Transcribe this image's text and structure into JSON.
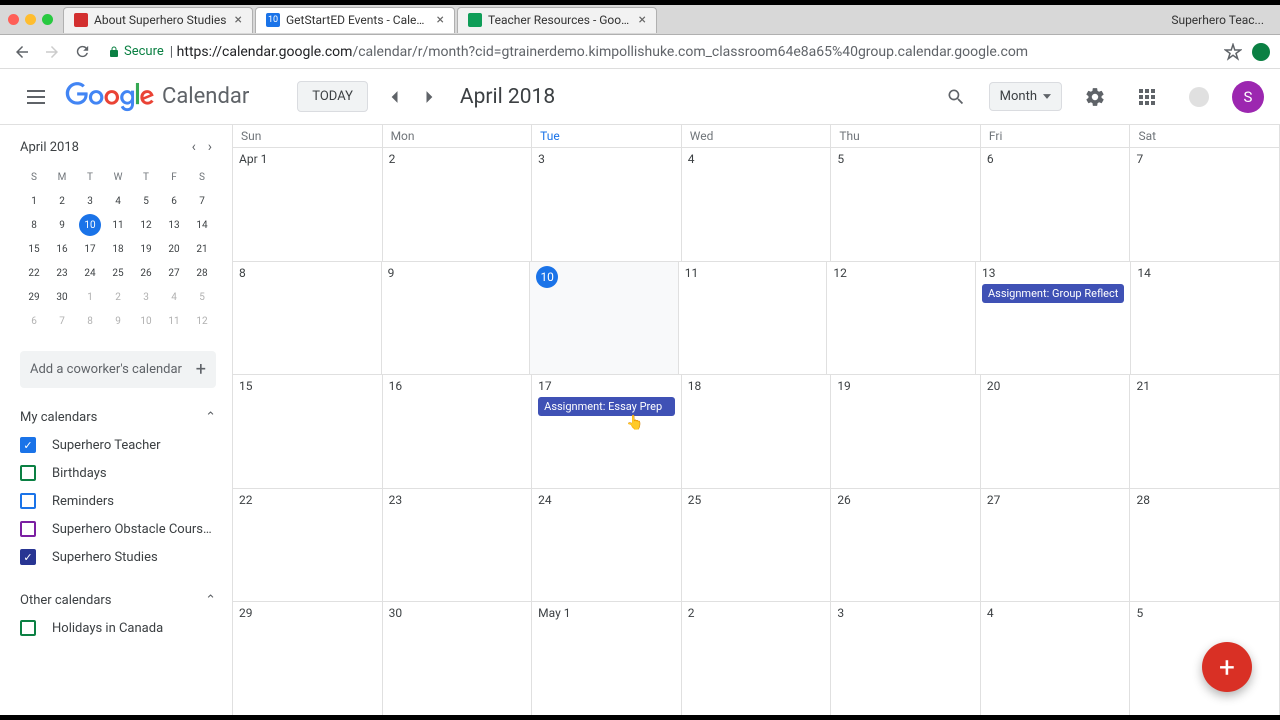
{
  "browser": {
    "tabs": [
      {
        "title": "About Superhero Studies",
        "favicon_bg": "#d32f2f"
      },
      {
        "title": "GetStartED Events - Calendar",
        "favicon_bg": "#1a73e8",
        "favicon_text": "10"
      },
      {
        "title": "Teacher Resources - Google D",
        "favicon_bg": "#0f9d58"
      }
    ],
    "profile": "Superhero Teac...",
    "secure_label": "Secure",
    "url_host": "https://calendar.google.com",
    "url_path": "/calendar/r/month?cid=gtrainerdemo.kimpollishuke.com_classroom64e8a65%40group.calendar.google.com"
  },
  "header": {
    "product": "Calendar",
    "today": "TODAY",
    "month_label": "April 2018",
    "view": "Month",
    "avatar_initial": "S"
  },
  "mini": {
    "month": "April 2018",
    "dows": [
      "S",
      "M",
      "T",
      "W",
      "T",
      "F",
      "S"
    ],
    "weeks": [
      [
        {
          "n": "1"
        },
        {
          "n": "2"
        },
        {
          "n": "3"
        },
        {
          "n": "4"
        },
        {
          "n": "5"
        },
        {
          "n": "6"
        },
        {
          "n": "7"
        }
      ],
      [
        {
          "n": "8"
        },
        {
          "n": "9"
        },
        {
          "n": "10",
          "today": true
        },
        {
          "n": "11"
        },
        {
          "n": "12"
        },
        {
          "n": "13"
        },
        {
          "n": "14"
        }
      ],
      [
        {
          "n": "15"
        },
        {
          "n": "16"
        },
        {
          "n": "17"
        },
        {
          "n": "18"
        },
        {
          "n": "19"
        },
        {
          "n": "20"
        },
        {
          "n": "21"
        }
      ],
      [
        {
          "n": "22"
        },
        {
          "n": "23"
        },
        {
          "n": "24"
        },
        {
          "n": "25"
        },
        {
          "n": "26"
        },
        {
          "n": "27"
        },
        {
          "n": "28"
        }
      ],
      [
        {
          "n": "29"
        },
        {
          "n": "30"
        },
        {
          "n": "1",
          "other": true
        },
        {
          "n": "2",
          "other": true
        },
        {
          "n": "3",
          "other": true
        },
        {
          "n": "4",
          "other": true
        },
        {
          "n": "5",
          "other": true
        }
      ],
      [
        {
          "n": "6",
          "other": true
        },
        {
          "n": "7",
          "other": true
        },
        {
          "n": "8",
          "other": true
        },
        {
          "n": "9",
          "other": true
        },
        {
          "n": "10",
          "other": true
        },
        {
          "n": "11",
          "other": true
        },
        {
          "n": "12",
          "other": true
        }
      ]
    ]
  },
  "sidebar": {
    "add_coworker": "Add a coworker's calendar",
    "my_calendars_title": "My calendars",
    "my_calendars": [
      {
        "label": "Superhero Teacher",
        "checked": true,
        "color": "cb-blue"
      },
      {
        "label": "Birthdays",
        "checked": false,
        "color": "cb-green"
      },
      {
        "label": "Reminders",
        "checked": false,
        "color": "cb-blue"
      },
      {
        "label": "Superhero Obstacle Course ...",
        "checked": false,
        "color": "cb-purple"
      },
      {
        "label": "Superhero Studies",
        "checked": true,
        "color": "cb-navy"
      }
    ],
    "other_calendars_title": "Other calendars",
    "other_calendars": [
      {
        "label": "Holidays in Canada",
        "checked": false,
        "color": "cb-green"
      }
    ]
  },
  "grid": {
    "dows": [
      "Sun",
      "Mon",
      "Tue",
      "Wed",
      "Thu",
      "Fri",
      "Sat"
    ],
    "today_col": 2,
    "weeks": [
      {
        "days": [
          {
            "n": "Apr 1"
          },
          {
            "n": "2"
          },
          {
            "n": "3"
          },
          {
            "n": "4"
          },
          {
            "n": "5"
          },
          {
            "n": "6"
          },
          {
            "n": "7"
          }
        ],
        "events": []
      },
      {
        "days": [
          {
            "n": "8"
          },
          {
            "n": "9"
          },
          {
            "n": "10",
            "today": true
          },
          {
            "n": "11"
          },
          {
            "n": "12"
          },
          {
            "n": "13"
          },
          {
            "n": "14"
          }
        ],
        "events": [
          {
            "col": 5,
            "label": "Assignment: Group Reflect"
          }
        ]
      },
      {
        "days": [
          {
            "n": "15"
          },
          {
            "n": "16"
          },
          {
            "n": "17"
          },
          {
            "n": "18"
          },
          {
            "n": "19"
          },
          {
            "n": "20"
          },
          {
            "n": "21"
          }
        ],
        "events": [
          {
            "col": 2,
            "label": "Assignment: Essay Prep"
          }
        ]
      },
      {
        "days": [
          {
            "n": "22"
          },
          {
            "n": "23"
          },
          {
            "n": "24"
          },
          {
            "n": "25"
          },
          {
            "n": "26"
          },
          {
            "n": "27"
          },
          {
            "n": "28"
          }
        ],
        "events": []
      },
      {
        "days": [
          {
            "n": "29"
          },
          {
            "n": "30"
          },
          {
            "n": "May 1"
          },
          {
            "n": "2"
          },
          {
            "n": "3"
          },
          {
            "n": "4"
          },
          {
            "n": "5"
          }
        ],
        "events": []
      }
    ]
  }
}
